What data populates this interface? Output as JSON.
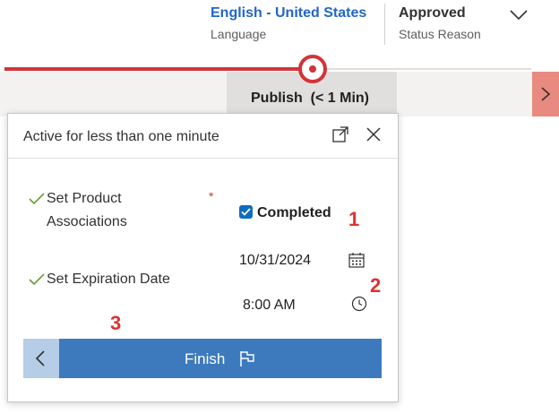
{
  "header": {
    "language": {
      "value": "English - United States",
      "label": "Language"
    },
    "status_reason": {
      "value": "Approved",
      "label": "Status Reason"
    }
  },
  "process": {
    "active_stage_label": "Publish",
    "active_stage_duration": "(< 1 Min)"
  },
  "flyout": {
    "title": "Active for less than one minute",
    "steps": [
      {
        "label_line1": "Set Product",
        "label_line2": "Associations",
        "required": "*",
        "checkbox_label": "Completed",
        "checked": true
      },
      {
        "label": "Set Expiration Date",
        "date": "10/31/2024",
        "time": "8:00 AM"
      }
    ],
    "finish_label": "Finish"
  },
  "annotations": [
    "1",
    "2",
    "3"
  ],
  "colors": {
    "accent_red": "#d13438",
    "link_blue": "#2266c9",
    "finish_blue": "#3d7abd",
    "annotation_red": "#e03131"
  }
}
